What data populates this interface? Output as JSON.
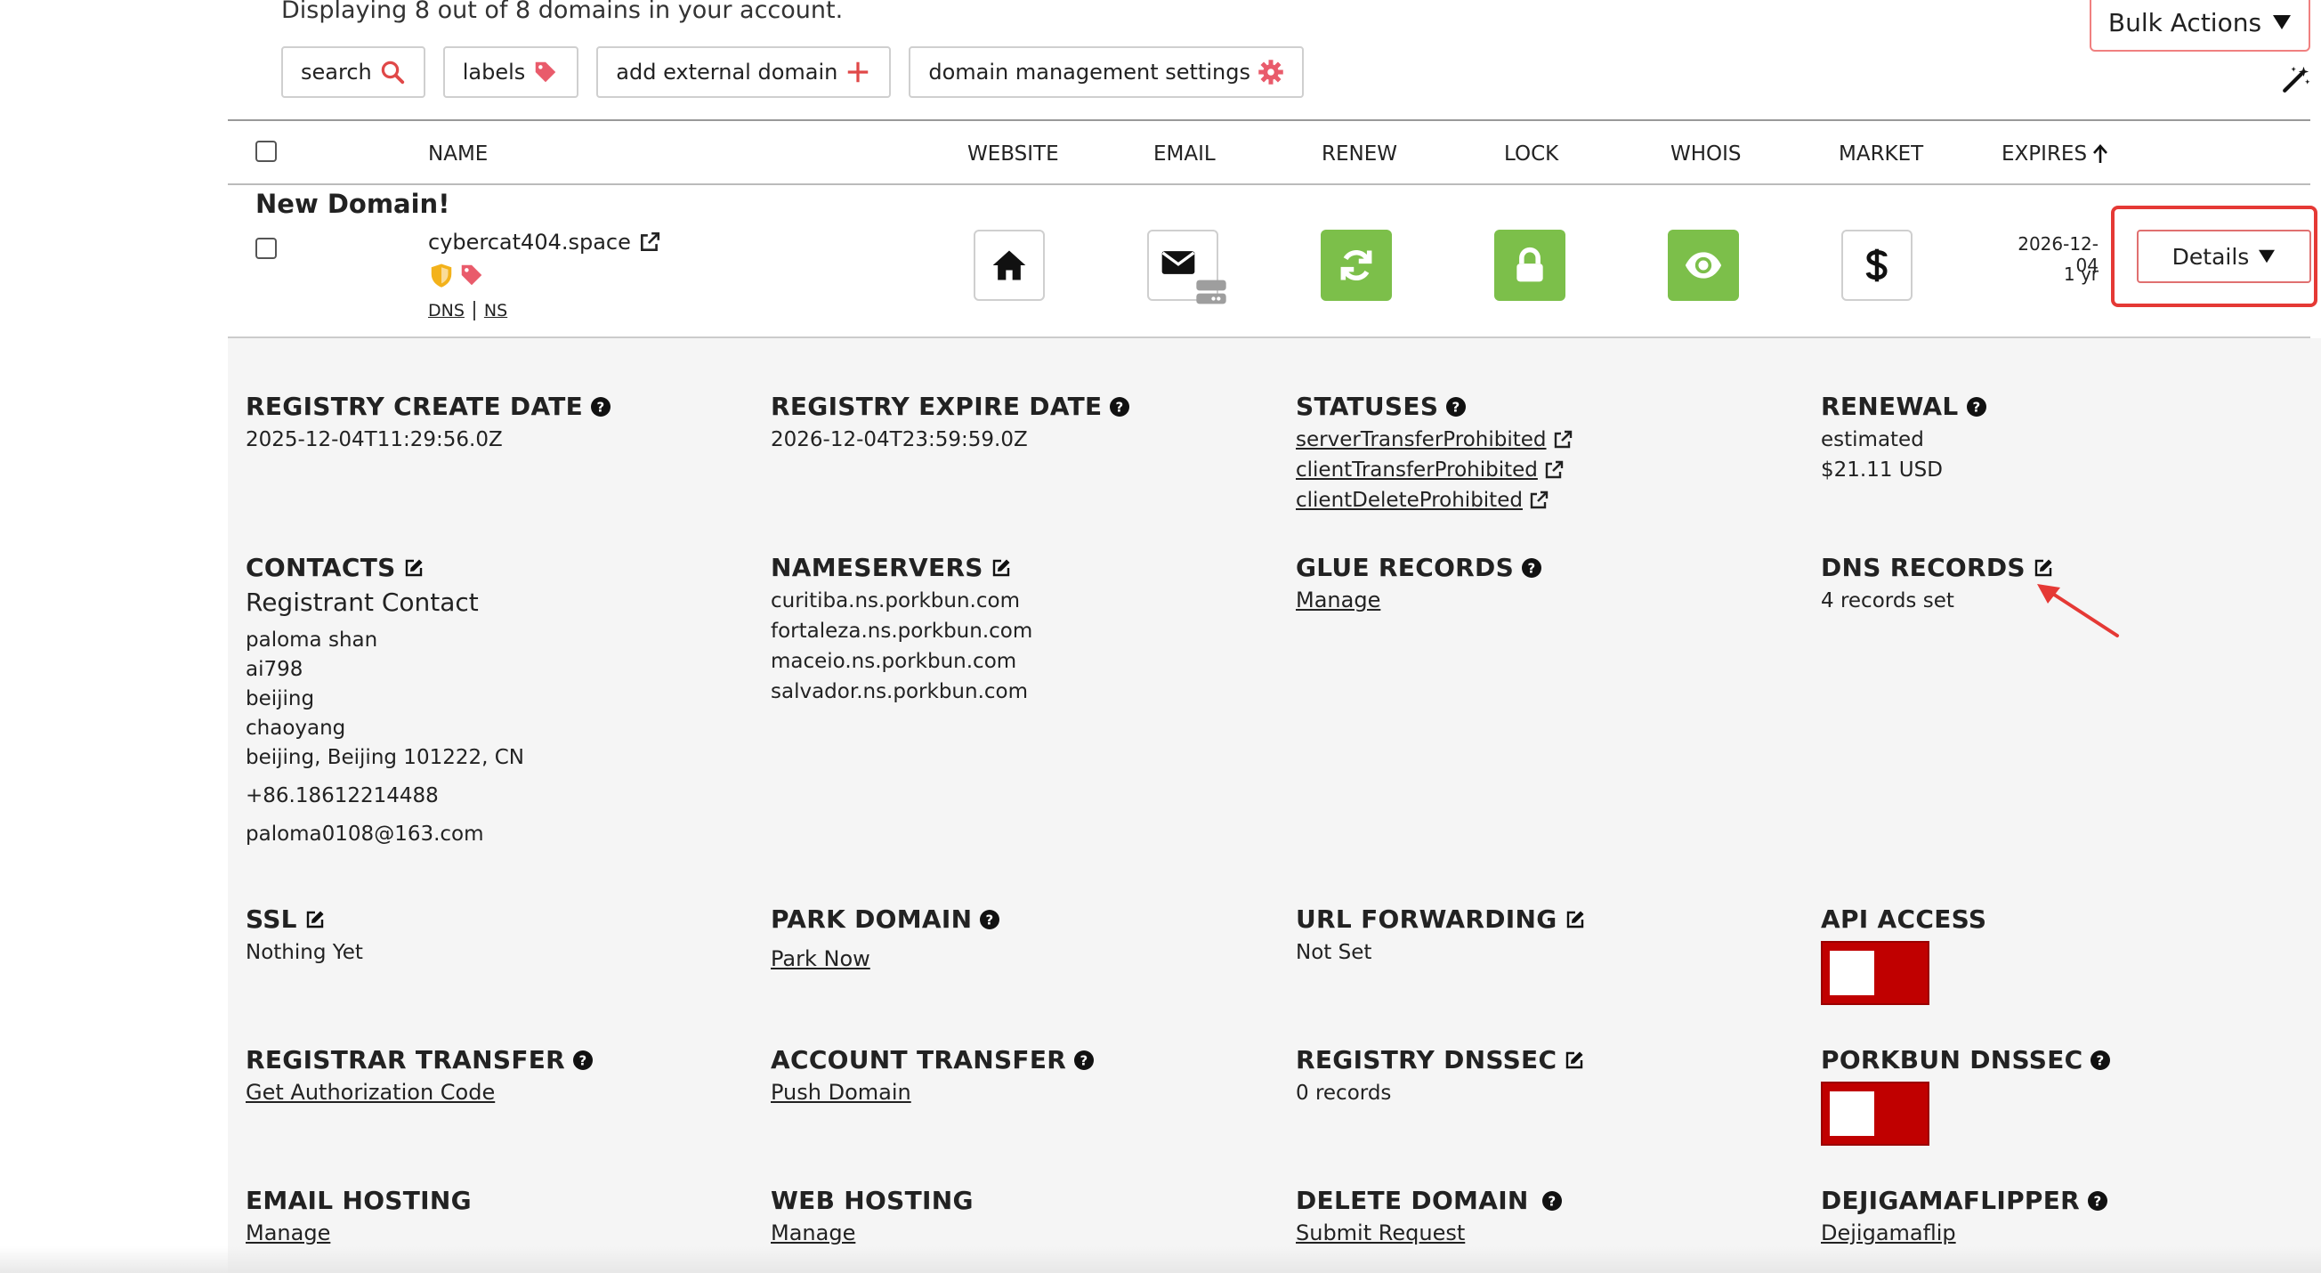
{
  "summary": "Displaying 8 out of 8 domains in your account.",
  "toolbar": {
    "search": "search",
    "labels": "labels",
    "add_external": "add external domain",
    "settings": "domain management settings"
  },
  "bulk_actions": "Bulk Actions",
  "columns": {
    "name": "NAME",
    "website": "WEBSITE",
    "email": "EMAIL",
    "renew": "RENEW",
    "lock": "LOCK",
    "whois": "WHOIS",
    "market": "MARKET",
    "expires": "EXPIRES"
  },
  "domain": {
    "section_label": "New Domain!",
    "name": "cybercat404.space",
    "dns_link": "DNS",
    "ns_link": "NS",
    "expires_date": "2026-12-04",
    "expires_term": "1 yr",
    "details_button": "Details"
  },
  "details": {
    "registry_create": {
      "label": "REGISTRY CREATE DATE",
      "value": "2025-12-04T11:29:56.0Z"
    },
    "registry_expire": {
      "label": "REGISTRY EXPIRE DATE",
      "value": "2026-12-04T23:59:59.0Z"
    },
    "statuses": {
      "label": "STATUSES",
      "items": [
        "serverTransferProhibited",
        "clientTransferProhibited",
        "clientDeleteProhibited"
      ]
    },
    "renewal": {
      "label": "RENEWAL",
      "line1": "estimated",
      "line2": "$21.11 USD"
    },
    "contacts": {
      "label": "CONTACTS",
      "subtitle": "Registrant Contact",
      "name": "paloma shan",
      "org": "ai798",
      "street1": "beijing",
      "street2": "chaoyang",
      "city_line": "beijing, Beijing 101222, CN",
      "phone": "+86.18612214488",
      "email": "paloma0108@163.com"
    },
    "nameservers": {
      "label": "NAMESERVERS",
      "items": [
        "curitiba.ns.porkbun.com",
        "fortaleza.ns.porkbun.com",
        "maceio.ns.porkbun.com",
        "salvador.ns.porkbun.com"
      ]
    },
    "glue_records": {
      "label": "GLUE RECORDS",
      "link": "Manage"
    },
    "dns_records": {
      "label": "DNS RECORDS",
      "value": "4 records set"
    },
    "ssl": {
      "label": "SSL",
      "value": "Nothing Yet"
    },
    "park_domain": {
      "label": "PARK DOMAIN",
      "link": "Park Now"
    },
    "url_forwarding": {
      "label": "URL FORWARDING",
      "value": "Not Set"
    },
    "api_access": {
      "label": "API ACCESS",
      "enabled": false
    },
    "registrar_transfer": {
      "label": "REGISTRAR TRANSFER",
      "link": "Get Authorization Code"
    },
    "account_transfer": {
      "label": "ACCOUNT TRANSFER",
      "link": "Push Domain"
    },
    "registry_dnssec": {
      "label": "REGISTRY DNSSEC",
      "value": "0 records"
    },
    "porkbun_dnssec": {
      "label": "PORKBUN DNSSEC",
      "enabled": false
    },
    "email_hosting": {
      "label": "EMAIL HOSTING",
      "link": "Manage"
    },
    "web_hosting": {
      "label": "WEB HOSTING",
      "link": "Manage"
    },
    "delete_domain": {
      "label": "DELETE DOMAIN",
      "link": "Submit Request"
    },
    "dejigamaflipper": {
      "label": "DEJIGAMAFLIPPER",
      "link": "Dejigamaflip"
    }
  },
  "colors": {
    "accent_red": "#e53935",
    "green": "#7cbf4a",
    "toggle_red": "#c00000"
  }
}
